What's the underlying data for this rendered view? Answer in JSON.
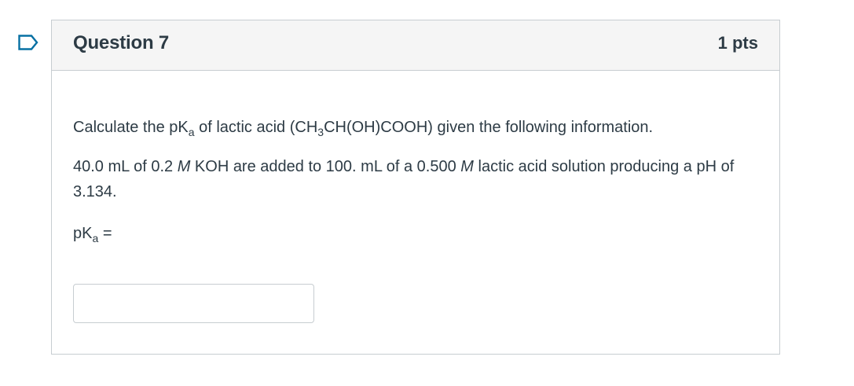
{
  "flag_icon": "bookmark-flag-icon",
  "question": {
    "title": "Question 7",
    "points": "1 pts",
    "line1": {
      "a": "Calculate the pK",
      "a_sub": "a",
      "b": " of lactic acid (CH",
      "b_sub": "3",
      "c": "CH(OH)COOH) given the following information."
    },
    "line2": {
      "a": "40.0 mL of 0.2 ",
      "m1": "M",
      "b": " KOH are added to 100. mL of a 0.500 ",
      "m2": "M",
      "c": " lactic acid solution producing a pH of 3.134."
    },
    "line3": {
      "a": "pK",
      "a_sub": "a",
      "b": " ="
    },
    "answer_value": ""
  },
  "colors": {
    "accent": "#0770a3",
    "border": "#c7cdd1",
    "header_bg": "#f5f5f5",
    "text": "#2d3b45"
  }
}
